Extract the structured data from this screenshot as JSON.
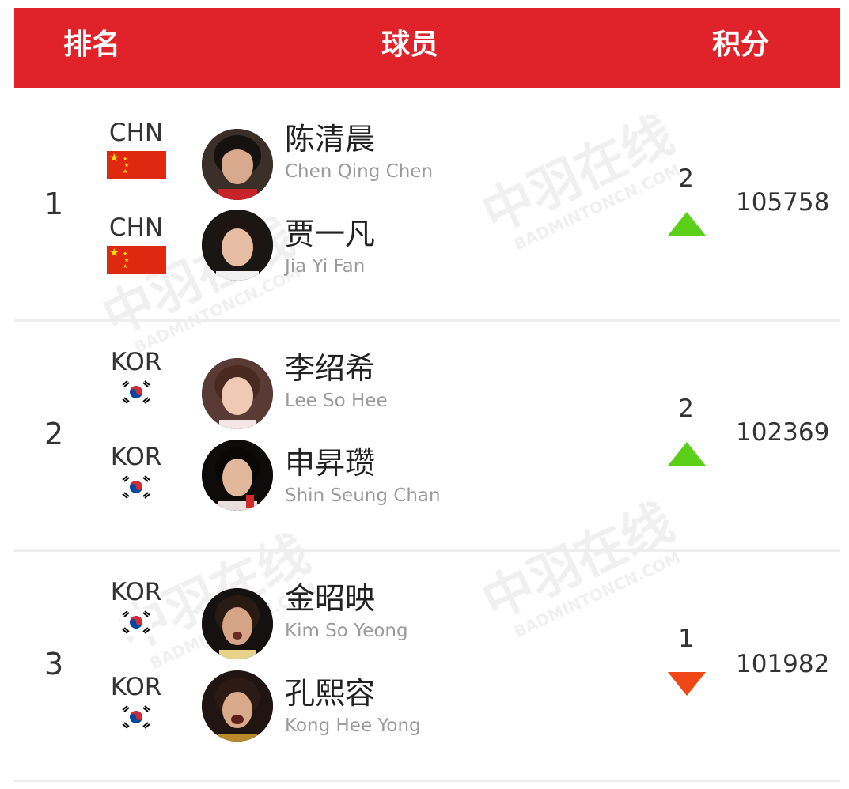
{
  "header": {
    "rank": "排名",
    "player": "球员",
    "points": "积分"
  },
  "rows": [
    {
      "rank": "1",
      "players": [
        {
          "country": "CHN",
          "flag": "china-flag",
          "name_cn": "陈清晨",
          "name_en": "Chen Qing Chen"
        },
        {
          "country": "CHN",
          "flag": "china-flag",
          "name_cn": "贾一凡",
          "name_en": "Jia Yi Fan"
        }
      ],
      "change": "2",
      "trend": "up",
      "points": "105758"
    },
    {
      "rank": "2",
      "players": [
        {
          "country": "KOR",
          "flag": "korea-flag",
          "name_cn": "李绍希",
          "name_en": "Lee So Hee"
        },
        {
          "country": "KOR",
          "flag": "korea-flag",
          "name_cn": "申昇瓒",
          "name_en": "Shin Seung Chan"
        }
      ],
      "change": "2",
      "trend": "up",
      "points": "102369"
    },
    {
      "rank": "3",
      "players": [
        {
          "country": "KOR",
          "flag": "korea-flag",
          "name_cn": "金昭映",
          "name_en": "Kim So Yeong"
        },
        {
          "country": "KOR",
          "flag": "korea-flag",
          "name_cn": "孔熙容",
          "name_en": "Kong Hee Yong"
        }
      ],
      "change": "1",
      "trend": "down",
      "points": "101982"
    }
  ],
  "colors": {
    "header_bg": "#e0222b",
    "trend_up": "#5ccf19",
    "trend_down": "#f14616"
  },
  "watermark": {
    "cn": "中羽在线",
    "en": "BADMINTONCN.COM"
  }
}
